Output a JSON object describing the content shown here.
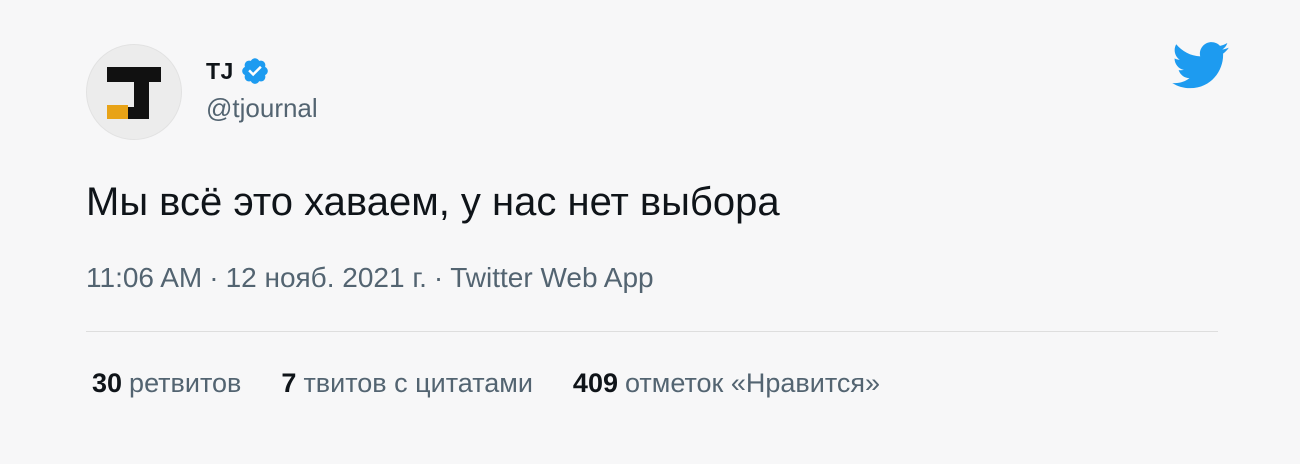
{
  "author": {
    "display_name": "TJ",
    "handle": "@tjournal",
    "verified": true,
    "avatar_icon": "tj-logo-icon",
    "avatar_colors": {
      "bg": "#ececec",
      "letter": "#111111",
      "accent": "#e8a317"
    }
  },
  "brand": {
    "icon": "twitter-bird-icon",
    "color": "#1d9bf0"
  },
  "tweet": {
    "text": "Мы всё это хаваем, у нас нет выбора"
  },
  "meta": {
    "time": "11:06 AM",
    "date": "12 нояб. 2021 г.",
    "source": "Twitter Web App",
    "separator": "·"
  },
  "stats": [
    {
      "count": "30",
      "label": "ретвитов"
    },
    {
      "count": "7",
      "label": "твитов с цитатами"
    },
    {
      "count": "409",
      "label": "отметок «Нравится»"
    }
  ]
}
